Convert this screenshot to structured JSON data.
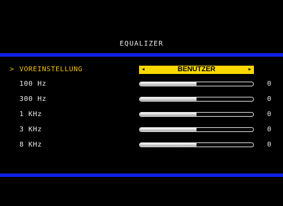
{
  "osd": {
    "title": "EQUALIZER",
    "accent_color": "#1020e8",
    "highlight_color": "#f8d800"
  },
  "preset": {
    "cursor": ">",
    "label": "VOREINSTELLUNG",
    "value": "BENUTZER",
    "left_arrow": "◄",
    "right_arrow": "►"
  },
  "bands": [
    {
      "label": "100 Hz",
      "value": "0",
      "level": 0.5
    },
    {
      "label": "300 Hz",
      "value": "0",
      "level": 0.5
    },
    {
      "label": "1 KHz",
      "value": "0",
      "level": 0.5
    },
    {
      "label": "3 KHz",
      "value": "0",
      "level": 0.5
    },
    {
      "label": "8 KHz",
      "value": "0",
      "level": 0.5
    }
  ]
}
